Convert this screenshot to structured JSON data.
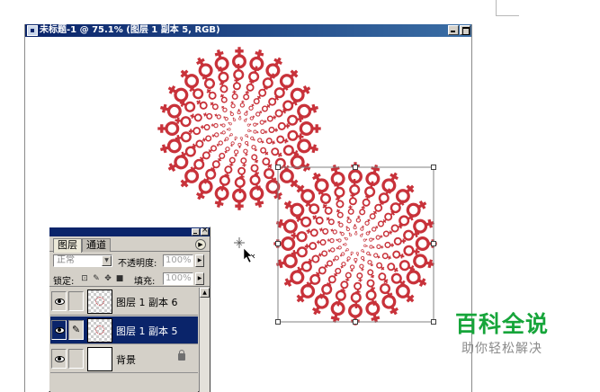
{
  "document": {
    "title": "未标题-1 @ 75.1% (图层 1 副本 5, RGB)"
  },
  "layers_panel": {
    "tabs": [
      {
        "label": "图层",
        "active": true
      },
      {
        "label": "通道",
        "active": false
      }
    ],
    "blend_mode": "正常",
    "opacity_label": "不透明度:",
    "opacity_value": "100%",
    "lock_label": "锁定:",
    "fill_label": "填充:",
    "fill_value": "100%",
    "layers": [
      {
        "name": "图层 1 副本 6",
        "visible": true,
        "selected": false,
        "thumbnail": "transparent-with-art"
      },
      {
        "name": "图层 1 副本 5",
        "visible": true,
        "selected": true,
        "thumbnail": "transparent-with-art"
      },
      {
        "name": "背景",
        "visible": true,
        "selected": false,
        "locked": true,
        "thumbnail": "white"
      }
    ]
  },
  "watermark": {
    "title": "百科全说",
    "subtitle": "助你轻松解决"
  },
  "colors": {
    "artwork": "#c8323a",
    "title_bar": "#0a246a",
    "selected_layer": "#0a246a",
    "watermark_green": "#16a53a",
    "panel_face": "#d4d0c8"
  },
  "icons": {
    "artwork_symbol": "female-venus-symbol",
    "cursor": "move-tool-cursor",
    "anchor": "crosshair-sparkle-icon"
  }
}
